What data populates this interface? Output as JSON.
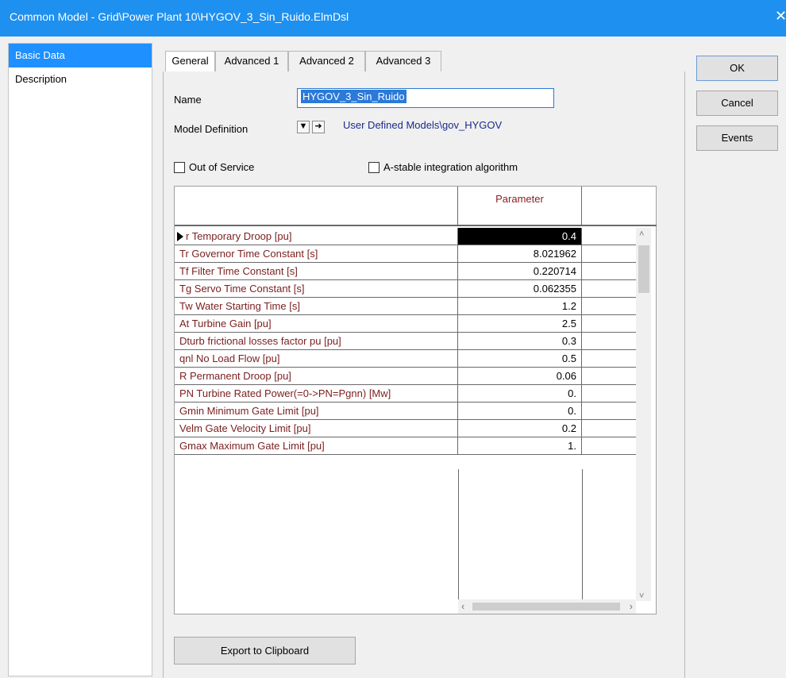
{
  "window": {
    "title": "Common Model - Grid\\Power Plant 10\\HYGOV_3_Sin_Ruido.ElmDsl",
    "close_glyph": "✕"
  },
  "sidebar": {
    "items": [
      {
        "label": "Basic Data",
        "active": true
      },
      {
        "label": "Description",
        "active": false
      }
    ]
  },
  "tabs": [
    {
      "label": "General",
      "active": true
    },
    {
      "label": "Advanced 1",
      "active": false
    },
    {
      "label": "Advanced 2",
      "active": false
    },
    {
      "label": "Advanced 3",
      "active": false
    }
  ],
  "form": {
    "name_label": "Name",
    "name_value": "HYGOV_3_Sin_Ruido",
    "model_def_label": "Model Definition",
    "model_def_value": "User Defined Models\\gov_HYGOV",
    "out_of_service_label": "Out of Service",
    "out_of_service_checked": false,
    "astable_label": "A-stable integration algorithm",
    "astable_checked": false
  },
  "grid": {
    "header": "Parameter",
    "rows": [
      {
        "name": "r   Temporary Droop [pu]",
        "value": "0.4",
        "selected": true
      },
      {
        "name": "Tr   Governor Time Constant [s]",
        "value": "8.021962"
      },
      {
        "name": "Tf   Filter Time Constant [s]",
        "value": "0.220714"
      },
      {
        "name": "Tg   Servo Time Constant [s]",
        "value": "0.062355"
      },
      {
        "name": "Tw   Water Starting Time [s]",
        "value": "1.2"
      },
      {
        "name": "At   Turbine Gain [pu]",
        "value": "2.5"
      },
      {
        "name": "Dturb frictional losses factor pu [pu]",
        "value": "0.3"
      },
      {
        "name": "qnl  No Load Flow [pu]",
        "value": "0.5"
      },
      {
        "name": "R    Permanent Droop [pu]",
        "value": "0.06"
      },
      {
        "name": "PN   Turbine Rated Power(=0->PN=Pgnn) [Mw]",
        "value": "0."
      },
      {
        "name": "Gmin  Minimum Gate Limit [pu]",
        "value": "0."
      },
      {
        "name": "Velm  Gate Velocity Limit [pu]",
        "value": "0.2"
      },
      {
        "name": "Gmax  Maximum Gate Limit [pu]",
        "value": "1."
      }
    ]
  },
  "buttons": {
    "ok": "OK",
    "cancel": "Cancel",
    "events": "Events",
    "export": "Export to Clipboard"
  }
}
